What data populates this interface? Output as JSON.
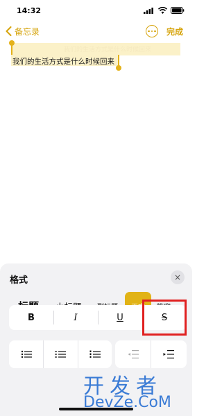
{
  "status_bar": {
    "time": "14:32"
  },
  "nav": {
    "back_label": "备忘录",
    "done_label": "完成"
  },
  "note": {
    "title_placeholder": "我们的生活方式是什么时候回来",
    "text": "我们的生活方式是什么时候回来"
  },
  "format_panel": {
    "title": "格式",
    "close_icon": "×",
    "styles": {
      "title": "标题",
      "heading": "小标题",
      "subheading": "副标题",
      "body": "正文",
      "monospaced": "等宽"
    },
    "text_styles": {
      "bold": "B",
      "italic": "I",
      "underline": "U",
      "strikethrough": "S"
    }
  },
  "watermark": {
    "line1": "开发者",
    "line2": "DevZe.CoM"
  },
  "colors": {
    "accent": "#e1b316",
    "highlight_border": "#e02020",
    "watermark": "#3a7bd5"
  }
}
